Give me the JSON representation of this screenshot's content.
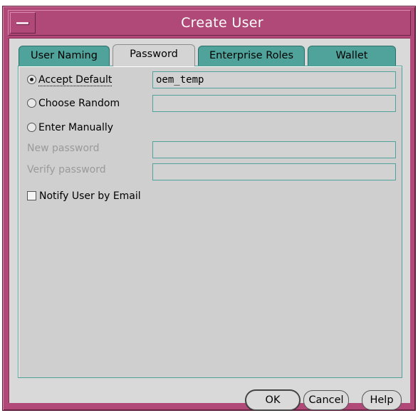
{
  "window": {
    "title": "Create User"
  },
  "tabs": [
    {
      "label": "User Naming",
      "active": false
    },
    {
      "label": "Password",
      "active": true
    },
    {
      "label": "Enterprise Roles",
      "active": false
    },
    {
      "label": "Wallet",
      "active": false
    }
  ],
  "password_tab": {
    "accept_default": {
      "label": "Accept Default",
      "selected": true,
      "value": "oem_temp"
    },
    "choose_random": {
      "label": "Choose Random",
      "selected": false,
      "value": ""
    },
    "enter_manually": {
      "label": "Enter Manually",
      "selected": false
    },
    "new_password": {
      "label": "New password",
      "value": ""
    },
    "verify_password": {
      "label": "Verify password",
      "value": ""
    },
    "notify_email": {
      "label": "Notify User by Email",
      "checked": false
    }
  },
  "buttons": {
    "ok": "OK",
    "cancel": "Cancel",
    "help": "Help"
  },
  "colors": {
    "frame": "#b04878",
    "tab": "#4fa39a",
    "panel": "#d9d9d9"
  }
}
